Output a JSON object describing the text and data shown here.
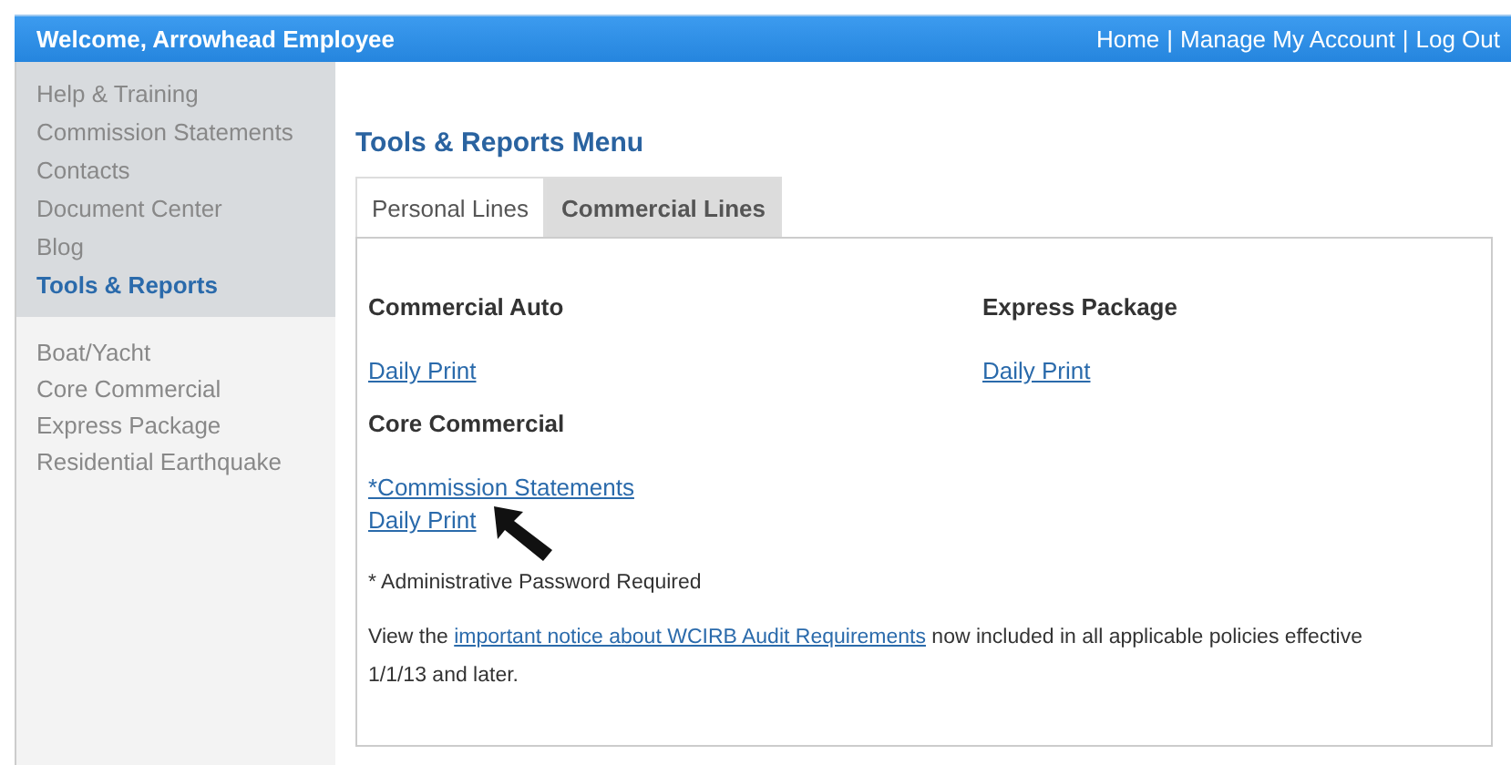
{
  "header": {
    "welcome": "Welcome, Arrowhead Employee",
    "nav": [
      "Home",
      "Manage My Account",
      "Log Out"
    ],
    "separator": "|"
  },
  "sidebar": {
    "items": [
      {
        "label": "Help & Training",
        "selected": false
      },
      {
        "label": "Commission Statements",
        "selected": false
      },
      {
        "label": "Contacts",
        "selected": false
      },
      {
        "label": "Document Center",
        "selected": false
      },
      {
        "label": "Blog",
        "selected": false
      },
      {
        "label": "Tools & Reports",
        "selected": true
      }
    ],
    "sub_items": [
      "Boat/Yacht",
      "Core Commercial",
      "Express Package",
      "Residential Earthquake"
    ]
  },
  "title": "Tools & Reports Menu",
  "tabs": [
    {
      "label": "Personal Lines",
      "selected": false
    },
    {
      "label": "Commercial Lines",
      "selected": true
    }
  ],
  "sections": [
    {
      "heading": "Commercial Auto",
      "links": [
        "Daily Print"
      ]
    },
    {
      "heading": "Express Package",
      "links": [
        "Daily Print"
      ]
    },
    {
      "heading": "Core Commercial",
      "links": [
        "*Commission Statements",
        "Daily Print"
      ]
    }
  ],
  "footnote": "* Administrative Password Required",
  "notice": {
    "before": "View the",
    "link": "important notice about WCIRB Audit Requirements",
    "after": "now included in all applicable policies effective 1/1/13 and later."
  }
}
